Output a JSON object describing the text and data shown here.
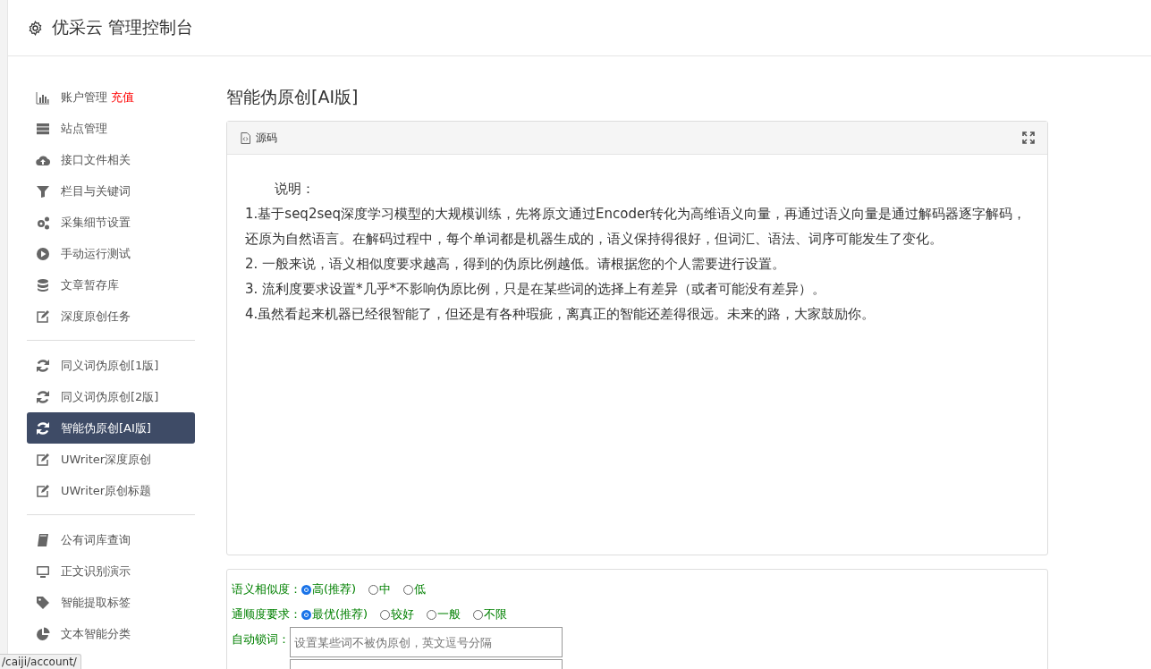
{
  "header": {
    "title": "优采云 管理控制台"
  },
  "sidebar": {
    "groups": [
      {
        "items": [
          {
            "label": "账户管理",
            "badge": "充值",
            "selected": false
          },
          {
            "label": "站点管理",
            "selected": false
          },
          {
            "label": "接口文件相关",
            "selected": false
          },
          {
            "label": "栏目与关键词",
            "selected": false
          },
          {
            "label": "采集细节设置",
            "selected": false
          },
          {
            "label": "手动运行测试",
            "selected": false
          },
          {
            "label": "文章暂存库",
            "selected": false
          },
          {
            "label": "深度原创任务",
            "selected": false
          }
        ]
      },
      {
        "items": [
          {
            "label": "同义词伪原创[1版]",
            "selected": false
          },
          {
            "label": "同义词伪原创[2版]",
            "selected": false
          },
          {
            "label": "智能伪原创[AI版]",
            "selected": true
          },
          {
            "label": "UWriter深度原创",
            "selected": false
          },
          {
            "label": "UWriter原创标题",
            "selected": false
          }
        ]
      },
      {
        "items": [
          {
            "label": "公有词库查询",
            "selected": false
          },
          {
            "label": "正文识别演示",
            "selected": false
          },
          {
            "label": "智能提取标签",
            "selected": false
          },
          {
            "label": "文本智能分类",
            "selected": false
          }
        ]
      }
    ]
  },
  "main": {
    "title": "智能伪原创[AI版]",
    "editor": {
      "toolbar_label": "源码",
      "lines": [
        "说明：",
        "1.基于seq2seq深度学习模型的大规模训练，先将原文通过Encoder转化为高维语义向量，再通过语义向量是通过解码器逐字解码，还原为自然语言。在解码过程中，每个单词都是机器生成的，语义保持得很好，但词汇、语法、词序可能发生了变化。",
        "2. 一般来说，语义相似度要求越高，得到的伪原比例越低。请根据您的个人需要进行设置。",
        "3. 流利度要求设置*几乎*不影响伪原比例，只是在某些词的选择上有差异（或者可能没有差异）。",
        "4.虽然看起来机器已经很智能了，但还是有各种瑕疵，离真正的智能还差得很远。未来的路，大家鼓励你。"
      ]
    },
    "options": {
      "similarity": {
        "label": "语义相似度：",
        "choices": [
          {
            "label": "高(推荐)",
            "selected": true
          },
          {
            "label": "中",
            "selected": false
          },
          {
            "label": "低",
            "selected": false
          }
        ]
      },
      "fluency": {
        "label": "通顺度要求：",
        "choices": [
          {
            "label": "最优(推荐)",
            "selected": true
          },
          {
            "label": "较好",
            "selected": false
          },
          {
            "label": "一般",
            "selected": false
          },
          {
            "label": "不限",
            "selected": false
          }
        ]
      },
      "lock_words": {
        "label": "自动锁词：",
        "placeholder": "设置某些词不被伪原创，英文逗号分隔"
      }
    }
  },
  "status_bar": {
    "url": "/caiji/account/"
  }
}
